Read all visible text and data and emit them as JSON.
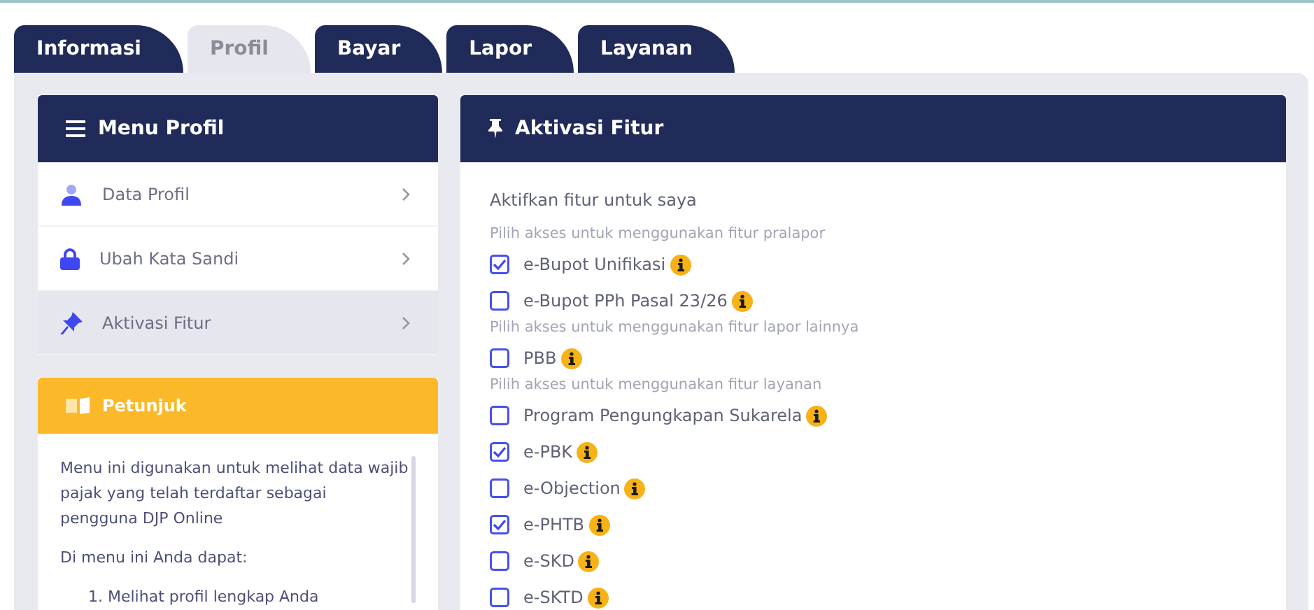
{
  "tabs": [
    {
      "label": "Informasi",
      "selected": false
    },
    {
      "label": "Profil",
      "selected": true
    },
    {
      "label": "Bayar",
      "selected": false
    },
    {
      "label": "Lapor",
      "selected": false
    },
    {
      "label": "Layanan",
      "selected": false
    }
  ],
  "menu": {
    "title": "Menu Profil",
    "items": [
      {
        "label": "Data Profil",
        "selected": false
      },
      {
        "label": "Ubah Kata Sandi",
        "selected": false
      },
      {
        "label": "Aktivasi Fitur",
        "selected": true
      }
    ]
  },
  "guide": {
    "title": "Petunjuk",
    "paragraphs": [
      "Menu ini digunakan untuk melihat data wajib pajak yang telah terdaftar sebagai pengguna DJP Online",
      "Di menu ini Anda dapat:"
    ],
    "steps": [
      "1. Melihat profil lengkap Anda"
    ]
  },
  "feature_panel": {
    "title": "Aktivasi Fitur",
    "intro": "Aktifkan fitur untuk saya",
    "sections": [
      {
        "label": "Pilih akses untuk menggunakan fitur pralapor",
        "items": [
          {
            "label": "e-Bupot Unifikasi",
            "checked": true
          },
          {
            "label": "e-Bupot PPh Pasal 23/26",
            "checked": false
          }
        ]
      },
      {
        "label": "Pilih akses untuk menggunakan fitur lapor lainnya",
        "items": [
          {
            "label": "PBB",
            "checked": false
          }
        ]
      },
      {
        "label": "Pilih akses untuk menggunakan fitur layanan",
        "items": [
          {
            "label": "Program Pengungkapan Sukarela",
            "checked": false
          },
          {
            "label": "e-PBK",
            "checked": true
          },
          {
            "label": "e-Objection",
            "checked": false
          },
          {
            "label": "e-PHTB",
            "checked": true
          },
          {
            "label": "e-SKD",
            "checked": false
          },
          {
            "label": "e-SKTD",
            "checked": false
          }
        ]
      }
    ]
  }
}
